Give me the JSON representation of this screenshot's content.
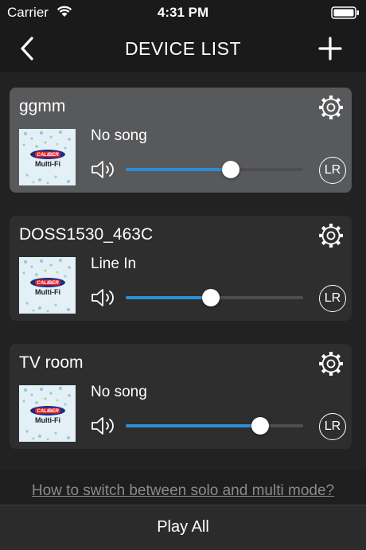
{
  "status_bar": {
    "carrier": "Carrier",
    "time": "4:31 PM"
  },
  "header": {
    "title": "DEVICE LIST"
  },
  "devices": [
    {
      "name": "ggmm",
      "song": "No song",
      "volume_percent": 59,
      "channel": "LR",
      "selected": true
    },
    {
      "name": "DOSS1530_463C",
      "song": "Line In",
      "volume_percent": 48,
      "channel": "LR",
      "selected": false
    },
    {
      "name": "TV room",
      "song": "No song",
      "volume_percent": 76,
      "channel": "LR",
      "selected": false
    }
  ],
  "thumbnail_logo": {
    "brand": "CALIBER",
    "product": "Multi-Fi"
  },
  "help_link": "How to switch between solo and multi mode?",
  "footer": {
    "play_all": "Play All"
  },
  "colors": {
    "accent": "#2a8fd6",
    "selected_card": "#58595b",
    "card": "#2e2e2e",
    "background": "#222222"
  },
  "icons": [
    "wifi-icon",
    "battery-icon",
    "back-chevron-icon",
    "plus-icon",
    "gear-icon",
    "speaker-icon",
    "lr-channel-icon"
  ]
}
